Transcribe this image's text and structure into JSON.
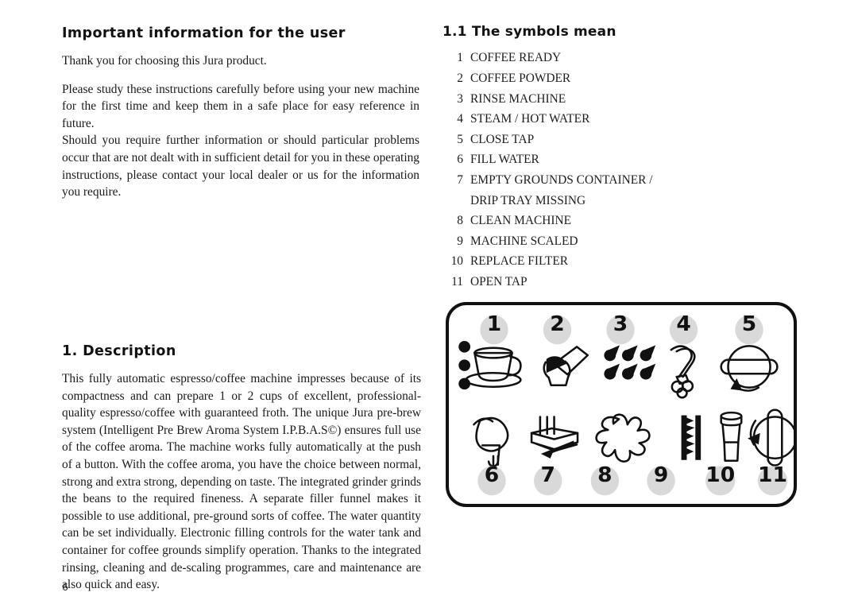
{
  "document": {
    "page_number": "6"
  },
  "left_column": {
    "heading": "Important information for the user",
    "paragraphs": [
      "Thank you for choosing this Jura product.",
      "Please study these instructions carefully before using your new machine for the first time and keep them in a safe place for easy reference in future.",
      "Should you require further information or should particular problems occur that are not dealt with in sufficient detail for you in these operating instructions, please contact your local dealer or us for the information you require."
    ],
    "description": {
      "heading": "1. Description",
      "text": "This fully automatic espresso/coffee machine impresses because of its compactness and can prepare 1 or 2 cups of excellent, professional-quality espresso/coffee with guaranteed froth. The unique Jura pre-brew system (Intelligent Pre Brew Aroma System I.P.B.A.S©) ensures full use of the coffee aroma. The machine works fully automatically at the push of a button. With the coffee aroma, you have the choice between normal, strong and extra strong, depending on taste. The integrated grinder grinds the beans to the required fineness. A separate filler funnel makes it possible to use additional, pre-ground sorts of coffee. The water quantity can be set individually. Electronic filling controls for the water tank and container for coffee grounds simplify operation. Thanks to the integrated rinsing, cleaning and de-scaling programmes, care and maintenance are also quick and easy."
    }
  },
  "right_column": {
    "heading": "1.1 The symbols mean",
    "legend": [
      {
        "num": "1",
        "label": "COFFEE READY",
        "label2": ""
      },
      {
        "num": "2",
        "label": "COFFEE POWDER",
        "label2": ""
      },
      {
        "num": "3",
        "label": "RINSE MACHINE",
        "label2": ""
      },
      {
        "num": "4",
        "label": "STEAM / HOT WATER",
        "label2": ""
      },
      {
        "num": "5",
        "label": "CLOSE TAP",
        "label2": ""
      },
      {
        "num": "6",
        "label": "FILL WATER",
        "label2": ""
      },
      {
        "num": "7",
        "label": "EMPTY GROUNDS CONTAINER /",
        "label2": "DRIP TRAY MISSING"
      },
      {
        "num": "8",
        "label": "CLEAN MACHINE",
        "label2": ""
      },
      {
        "num": "9",
        "label": "MACHINE SCALED",
        "label2": ""
      },
      {
        "num": "10",
        "label": "REPLACE FILTER",
        "label2": ""
      },
      {
        "num": "11",
        "label": "OPEN TAP",
        "label2": ""
      }
    ]
  },
  "symbol_panel": {
    "badge_color": "#d9d9d9",
    "border_color": "#111111",
    "top_row": [
      {
        "num": "1",
        "icon": "coffee-cup-icon"
      },
      {
        "num": "2",
        "icon": "coffee-scoop-icon"
      },
      {
        "num": "3",
        "icon": "water-droplets-icon"
      },
      {
        "num": "4",
        "icon": "steam-wand-icon"
      },
      {
        "num": "5",
        "icon": "close-tap-knob-icon"
      }
    ],
    "bottom_row": [
      {
        "num": "6",
        "icon": "water-jug-icon"
      },
      {
        "num": "7",
        "icon": "grounds-drawer-icon"
      },
      {
        "num": "8",
        "icon": "clean-swirl-icon"
      },
      {
        "num": "9",
        "icon": "limescale-bars-icon"
      },
      {
        "num": "10",
        "icon": "filter-cartridge-icon"
      },
      {
        "num": "11",
        "icon": "open-tap-knob-icon"
      }
    ]
  }
}
